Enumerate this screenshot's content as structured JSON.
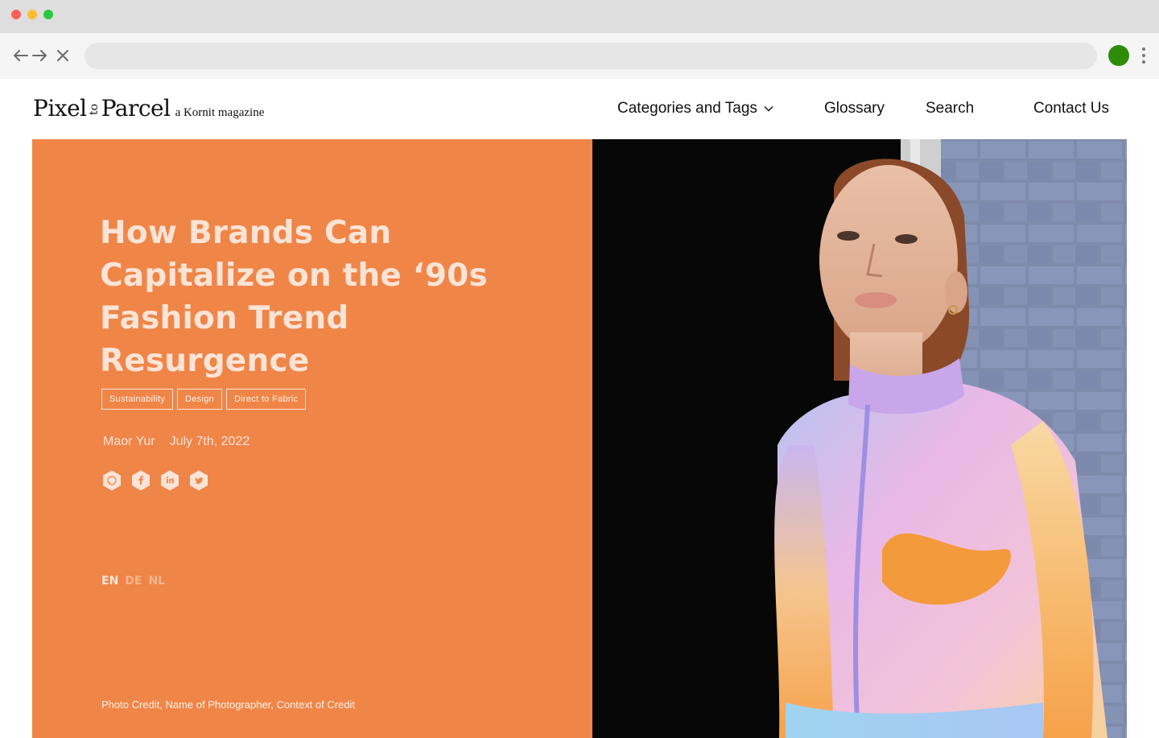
{
  "browser": {
    "address_placeholder": "",
    "colors": {
      "close": "#fe5f57",
      "minimize": "#febc2e",
      "zoom": "#28c840",
      "profile": "#2e8c08"
    },
    "icons": [
      "arrow-left-icon",
      "arrow-right-icon",
      "close-icon",
      "profile-icon",
      "kebab-menu-icon"
    ]
  },
  "header": {
    "logo": {
      "word1": "Pixel",
      "word2": "to",
      "word3": "Parcel",
      "tagline": "a Kornit magazine"
    },
    "nav": {
      "categories": "Categories and Tags",
      "glossary": "Glossary",
      "search": "Search",
      "contact": "Contact Us"
    }
  },
  "article": {
    "title": "How Brands Can Capitalize on the ‘90s Fashion Trend Resurgence",
    "tags": [
      "Sustainability",
      "Design",
      "Direct to Fabric"
    ],
    "author": "Maor Yur",
    "date": "July 7th, 2022",
    "share_icons": [
      "whatsapp-icon",
      "facebook-icon",
      "linkedin-icon",
      "twitter-icon"
    ],
    "languages": {
      "en": "EN",
      "de": "DE",
      "nl": "NL",
      "active": "EN"
    },
    "photo_credit": "Photo Credit, Name of Photographer, Context of Credit",
    "accent_color": "#f08548"
  }
}
